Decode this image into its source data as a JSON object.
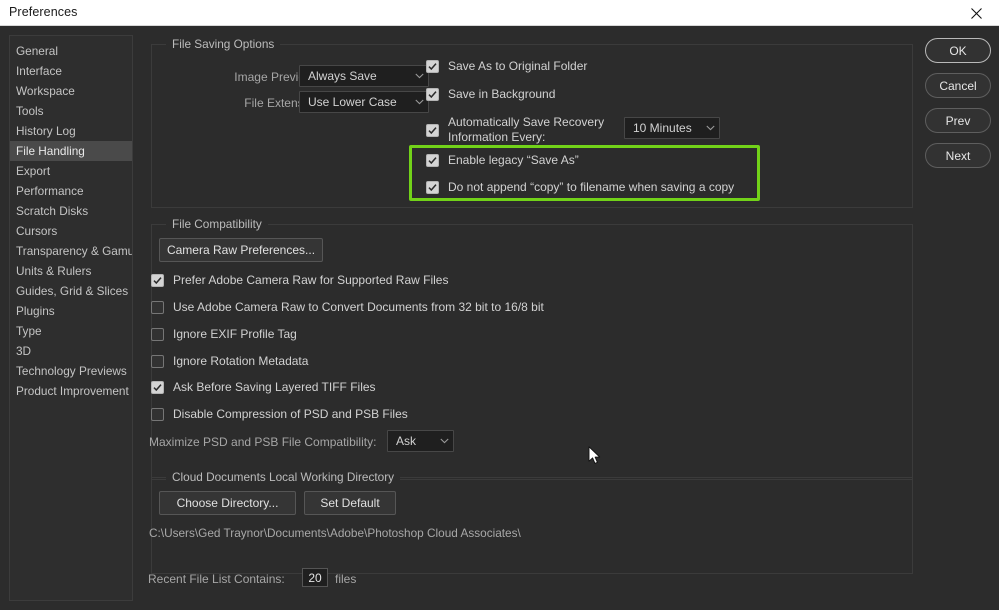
{
  "window": {
    "title": "Preferences",
    "close_icon": "close-icon"
  },
  "sidebar": {
    "items": [
      {
        "label": "General",
        "selected": false
      },
      {
        "label": "Interface",
        "selected": false
      },
      {
        "label": "Workspace",
        "selected": false
      },
      {
        "label": "Tools",
        "selected": false
      },
      {
        "label": "History Log",
        "selected": false
      },
      {
        "label": "File Handling",
        "selected": true
      },
      {
        "label": "Export",
        "selected": false
      },
      {
        "label": "Performance",
        "selected": false
      },
      {
        "label": "Scratch Disks",
        "selected": false
      },
      {
        "label": "Cursors",
        "selected": false
      },
      {
        "label": "Transparency & Gamut",
        "selected": false
      },
      {
        "label": "Units & Rulers",
        "selected": false
      },
      {
        "label": "Guides, Grid & Slices",
        "selected": false
      },
      {
        "label": "Plugins",
        "selected": false
      },
      {
        "label": "Type",
        "selected": false
      },
      {
        "label": "3D",
        "selected": false
      },
      {
        "label": "Technology Previews",
        "selected": false
      },
      {
        "label": "Product Improvement",
        "selected": false
      }
    ]
  },
  "file_saving": {
    "group_label": "File Saving Options",
    "image_previews_label": "Image Previews:",
    "image_previews_value": "Always Save",
    "file_extension_label": "File Extension:",
    "file_extension_value": "Use Lower Case",
    "save_as_original_folder": "Save As to Original Folder",
    "save_in_background": "Save in Background",
    "auto_save_recovery": "Automatically Save Recovery\nInformation Every:",
    "auto_save_interval": "10 Minutes",
    "enable_legacy_save_as": "Enable legacy “Save As”",
    "do_not_append_copy": "Do not append “copy” to filename when saving a copy"
  },
  "file_compatibility": {
    "group_label": "File Compatibility",
    "camera_raw_preferences_button": "Camera Raw Preferences...",
    "prefer_acr": "Prefer Adobe Camera Raw for Supported Raw Files",
    "use_acr_convert": "Use Adobe Camera Raw to Convert Documents from 32 bit to 16/8 bit",
    "ignore_exif": "Ignore EXIF Profile Tag",
    "ignore_rotation": "Ignore Rotation Metadata",
    "ask_before_tiff": "Ask Before Saving Layered TIFF Files",
    "disable_compression": "Disable Compression of PSD and PSB Files",
    "maximize_label": "Maximize PSD and PSB File Compatibility:",
    "maximize_value": "Ask"
  },
  "cloud_documents": {
    "group_label": "Cloud Documents Local Working Directory",
    "choose_directory_button": "Choose Directory...",
    "set_default_button": "Set Default",
    "path": "C:\\Users\\Ged Traynor\\Documents\\Adobe\\Photoshop Cloud Associates\\"
  },
  "recent_files": {
    "label": "Recent File List Contains:",
    "value": "20",
    "suffix": "files"
  },
  "actions": {
    "ok": "OK",
    "cancel": "Cancel",
    "prev": "Prev",
    "next": "Next"
  },
  "colors": {
    "highlight_green": "#72d219",
    "dialog_bg": "#2c2c2c",
    "selected_item_bg": "#4a4a4a",
    "titlebar_bg": "#ffffff"
  }
}
